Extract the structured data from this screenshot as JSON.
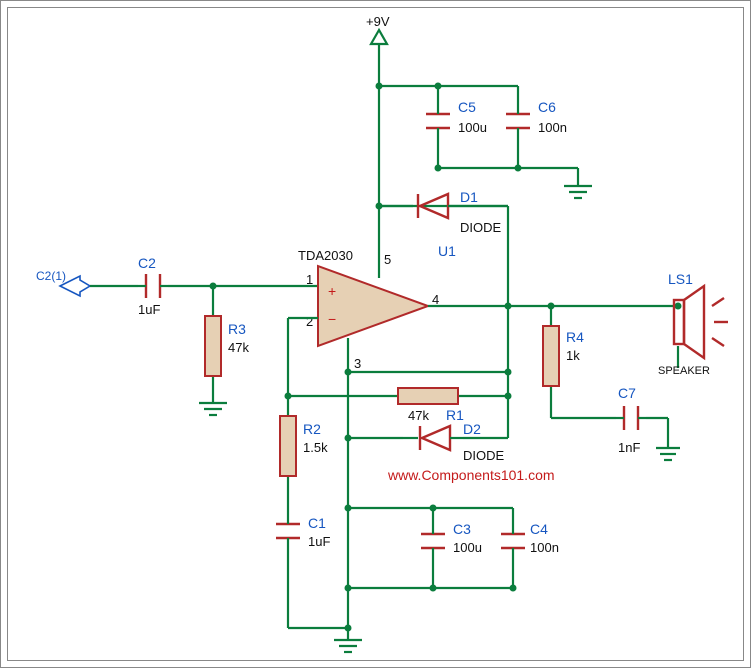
{
  "schematic": {
    "power": "+9V",
    "url": "www.Components101.com",
    "ic": {
      "name": "U1",
      "part": "TDA2030"
    },
    "input_port": {
      "name": "C2(1)"
    },
    "speaker": {
      "name": "LS1",
      "label": "SPEAKER"
    },
    "caps": {
      "C1": {
        "name": "C1",
        "value": "1uF"
      },
      "C2": {
        "name": "C2",
        "value": "1uF"
      },
      "C3": {
        "name": "C3",
        "value": "100u"
      },
      "C4": {
        "name": "C4",
        "value": "100n"
      },
      "C5": {
        "name": "C5",
        "value": "100u"
      },
      "C6": {
        "name": "C6",
        "value": "100n"
      },
      "C7": {
        "name": "C7",
        "value": "1nF"
      }
    },
    "res": {
      "R1": {
        "name": "R1",
        "value": "47k"
      },
      "R2": {
        "name": "R2",
        "value": "1.5k"
      },
      "R3": {
        "name": "R3",
        "value": "47k"
      },
      "R4": {
        "name": "R4",
        "value": "1k"
      }
    },
    "diodes": {
      "D1": {
        "name": "D1",
        "value": "DIODE"
      },
      "D2": {
        "name": "D2",
        "value": "DIODE"
      }
    },
    "pins": {
      "p1": "1",
      "p2": "2",
      "p3": "3",
      "p4": "4",
      "p5": "5"
    },
    "opamp": {
      "plus": "+",
      "minus": "−"
    }
  }
}
